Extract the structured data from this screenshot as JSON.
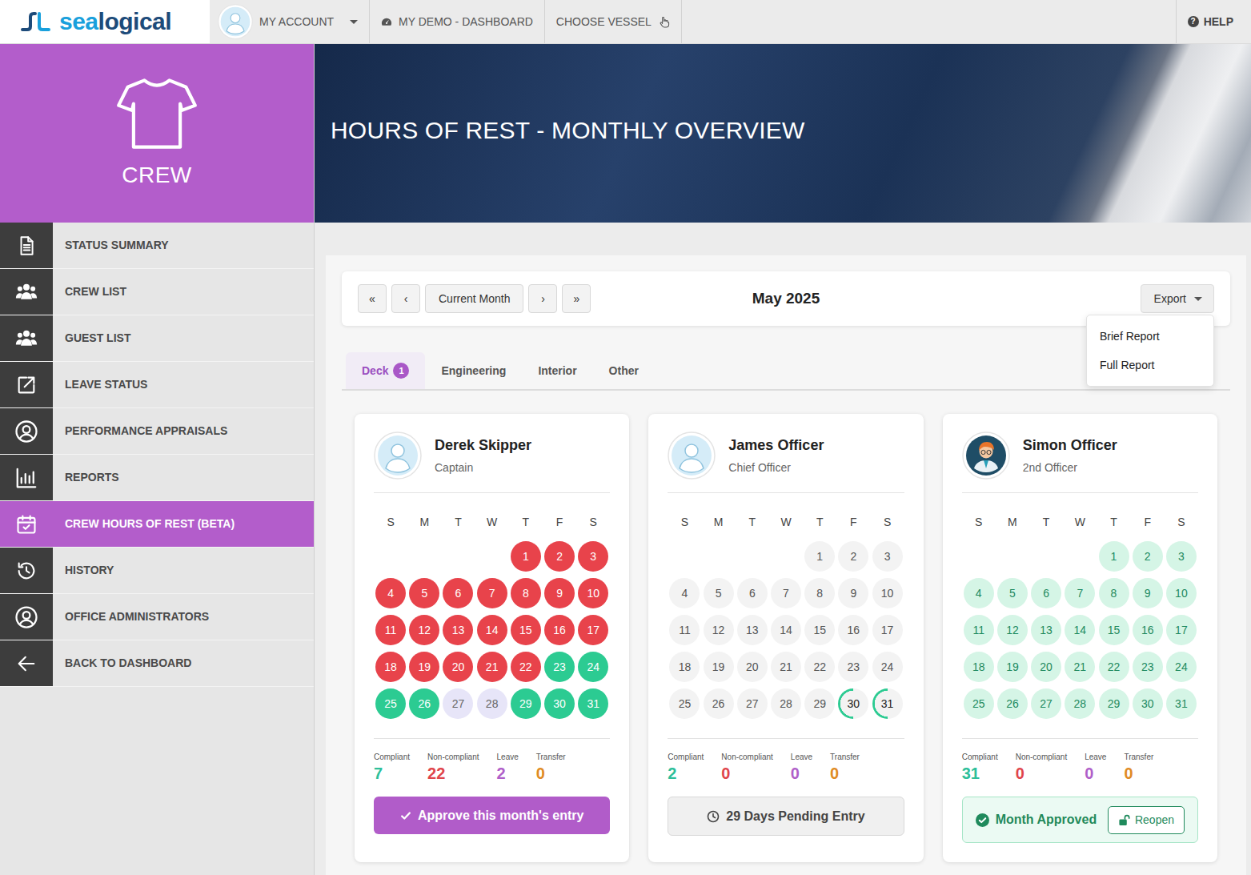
{
  "navbar": {
    "logo": {
      "part1": "sea",
      "part2": "logical"
    },
    "account": {
      "label": "MY ACCOUNT"
    },
    "links": [
      {
        "label": "MY DEMO - DASHBOARD"
      },
      {
        "label": "CHOOSE VESSEL"
      }
    ],
    "help": {
      "icon": "?",
      "label": "HELP"
    }
  },
  "sidebar": {
    "section": "CREW",
    "items": [
      {
        "label": "STATUS SUMMARY",
        "selected": false
      },
      {
        "label": "CREW LIST",
        "selected": false
      },
      {
        "label": "GUEST LIST",
        "selected": false
      },
      {
        "label": "LEAVE STATUS",
        "selected": false
      },
      {
        "label": "PERFORMANCE APPRAISALS",
        "selected": false
      },
      {
        "label": "REPORTS",
        "selected": false
      },
      {
        "label": "CREW HOURS OF REST (BETA)",
        "selected": true
      },
      {
        "label": "HISTORY",
        "selected": false
      },
      {
        "label": "OFFICE ADMINISTRATORS",
        "selected": false
      },
      {
        "label": "BACK TO DASHBOARD",
        "selected": false
      }
    ]
  },
  "hero": {
    "title": "HOURS OF REST - MONTHLY OVERVIEW"
  },
  "toolbar": {
    "nav_buttons": [
      "«",
      "‹",
      "Current Month",
      "›",
      "»"
    ],
    "month": "May 2025",
    "export": {
      "label": "Export",
      "expanded": true,
      "items": [
        "Brief Report",
        "Full Report"
      ]
    }
  },
  "tabs": [
    {
      "label": "Deck",
      "selected": true,
      "badge": "1"
    },
    {
      "label": "Engineering",
      "selected": false
    },
    {
      "label": "Interior",
      "selected": false
    },
    {
      "label": "Other",
      "selected": false
    }
  ],
  "weekdays": [
    "S",
    "M",
    "T",
    "W",
    "T",
    "F",
    "S"
  ],
  "cards": [
    {
      "name": "Derek Skipper",
      "role": "Captain",
      "avatar": "default",
      "days": [
        {
          "day": "1",
          "kind": "non-compliant"
        },
        {
          "day": "2",
          "kind": "non-compliant"
        },
        {
          "day": "3",
          "kind": "non-compliant"
        },
        {
          "day": "4",
          "kind": "non-compliant"
        },
        {
          "day": "5",
          "kind": "non-compliant"
        },
        {
          "day": "6",
          "kind": "non-compliant"
        },
        {
          "day": "7",
          "kind": "non-compliant"
        },
        {
          "day": "8",
          "kind": "non-compliant"
        },
        {
          "day": "9",
          "kind": "non-compliant"
        },
        {
          "day": "10",
          "kind": "non-compliant"
        },
        {
          "day": "11",
          "kind": "non-compliant"
        },
        {
          "day": "12",
          "kind": "non-compliant"
        },
        {
          "day": "13",
          "kind": "non-compliant"
        },
        {
          "day": "14",
          "kind": "non-compliant"
        },
        {
          "day": "15",
          "kind": "non-compliant"
        },
        {
          "day": "16",
          "kind": "non-compliant"
        },
        {
          "day": "17",
          "kind": "non-compliant"
        },
        {
          "day": "18",
          "kind": "non-compliant"
        },
        {
          "day": "19",
          "kind": "non-compliant"
        },
        {
          "day": "20",
          "kind": "non-compliant"
        },
        {
          "day": "21",
          "kind": "non-compliant"
        },
        {
          "day": "22",
          "kind": "non-compliant"
        },
        {
          "day": "23",
          "kind": "compliant"
        },
        {
          "day": "24",
          "kind": "compliant"
        },
        {
          "day": "25",
          "kind": "compliant"
        },
        {
          "day": "26",
          "kind": "compliant"
        },
        {
          "day": "27",
          "kind": "leave"
        },
        {
          "day": "28",
          "kind": "leave"
        },
        {
          "day": "29",
          "kind": "compliant"
        },
        {
          "day": "30",
          "kind": "compliant"
        },
        {
          "day": "31",
          "kind": "compliant"
        }
      ],
      "stats": [
        {
          "label": "Compliant",
          "value": "7",
          "color": "#2dbf9a"
        },
        {
          "label": "Non-compliant",
          "value": "22",
          "color": "#e0454b"
        },
        {
          "label": "Leave",
          "value": "2",
          "color": "#b05fc9"
        },
        {
          "label": "Transfer",
          "value": "0",
          "color": "#e08b24"
        }
      ],
      "footer": {
        "kind": "approve",
        "label": "Approve this month's entry"
      }
    },
    {
      "name": "James Officer",
      "role": "Chief Officer",
      "avatar": "default",
      "days": [
        {
          "day": "1",
          "kind": "pending"
        },
        {
          "day": "2",
          "kind": "pending"
        },
        {
          "day": "3",
          "kind": "pending"
        },
        {
          "day": "4",
          "kind": "pending"
        },
        {
          "day": "5",
          "kind": "pending"
        },
        {
          "day": "6",
          "kind": "pending"
        },
        {
          "day": "7",
          "kind": "pending"
        },
        {
          "day": "8",
          "kind": "pending"
        },
        {
          "day": "9",
          "kind": "pending"
        },
        {
          "day": "10",
          "kind": "pending"
        },
        {
          "day": "11",
          "kind": "pending"
        },
        {
          "day": "12",
          "kind": "pending"
        },
        {
          "day": "13",
          "kind": "pending"
        },
        {
          "day": "14",
          "kind": "pending"
        },
        {
          "day": "15",
          "kind": "pending"
        },
        {
          "day": "16",
          "kind": "pending"
        },
        {
          "day": "17",
          "kind": "pending"
        },
        {
          "day": "18",
          "kind": "pending"
        },
        {
          "day": "19",
          "kind": "pending"
        },
        {
          "day": "20",
          "kind": "pending"
        },
        {
          "day": "21",
          "kind": "pending"
        },
        {
          "day": "22",
          "kind": "pending"
        },
        {
          "day": "23",
          "kind": "pending"
        },
        {
          "day": "24",
          "kind": "pending"
        },
        {
          "day": "25",
          "kind": "pending"
        },
        {
          "day": "26",
          "kind": "pending"
        },
        {
          "day": "27",
          "kind": "pending"
        },
        {
          "day": "28",
          "kind": "pending"
        },
        {
          "day": "29",
          "kind": "pending"
        },
        {
          "day": "30",
          "kind": "partial"
        },
        {
          "day": "31",
          "kind": "partial"
        }
      ],
      "stats": [
        {
          "label": "Compliant",
          "value": "2",
          "color": "#2dbf9a"
        },
        {
          "label": "Non-compliant",
          "value": "0",
          "color": "#e0454b"
        },
        {
          "label": "Leave",
          "value": "0",
          "color": "#b05fc9"
        },
        {
          "label": "Transfer",
          "value": "0",
          "color": "#e08b24"
        }
      ],
      "footer": {
        "kind": "pending",
        "label": "29 Days Pending Entry"
      }
    },
    {
      "name": "Simon Officer",
      "role": "2nd Officer",
      "avatar": "custom",
      "days": [
        {
          "day": "1",
          "kind": "approved"
        },
        {
          "day": "2",
          "kind": "approved"
        },
        {
          "day": "3",
          "kind": "approved"
        },
        {
          "day": "4",
          "kind": "approved"
        },
        {
          "day": "5",
          "kind": "approved"
        },
        {
          "day": "6",
          "kind": "approved"
        },
        {
          "day": "7",
          "kind": "approved"
        },
        {
          "day": "8",
          "kind": "approved"
        },
        {
          "day": "9",
          "kind": "approved"
        },
        {
          "day": "10",
          "kind": "approved"
        },
        {
          "day": "11",
          "kind": "approved"
        },
        {
          "day": "12",
          "kind": "approved"
        },
        {
          "day": "13",
          "kind": "approved"
        },
        {
          "day": "14",
          "kind": "approved"
        },
        {
          "day": "15",
          "kind": "approved"
        },
        {
          "day": "16",
          "kind": "approved"
        },
        {
          "day": "17",
          "kind": "approved"
        },
        {
          "day": "18",
          "kind": "approved"
        },
        {
          "day": "19",
          "kind": "approved"
        },
        {
          "day": "20",
          "kind": "approved"
        },
        {
          "day": "21",
          "kind": "approved"
        },
        {
          "day": "22",
          "kind": "approved"
        },
        {
          "day": "23",
          "kind": "approved"
        },
        {
          "day": "24",
          "kind": "approved"
        },
        {
          "day": "25",
          "kind": "approved"
        },
        {
          "day": "26",
          "kind": "approved"
        },
        {
          "day": "27",
          "kind": "approved"
        },
        {
          "day": "28",
          "kind": "approved"
        },
        {
          "day": "29",
          "kind": "approved"
        },
        {
          "day": "30",
          "kind": "approved"
        },
        {
          "day": "31",
          "kind": "approved"
        }
      ],
      "stats": [
        {
          "label": "Compliant",
          "value": "31",
          "color": "#2dbf9a"
        },
        {
          "label": "Non-compliant",
          "value": "0",
          "color": "#e0454b"
        },
        {
          "label": "Leave",
          "value": "0",
          "color": "#b05fc9"
        },
        {
          "label": "Transfer",
          "value": "0",
          "color": "#e08b24"
        }
      ],
      "footer": {
        "kind": "approved",
        "label": "Month Approved",
        "button": "Reopen"
      }
    }
  ]
}
